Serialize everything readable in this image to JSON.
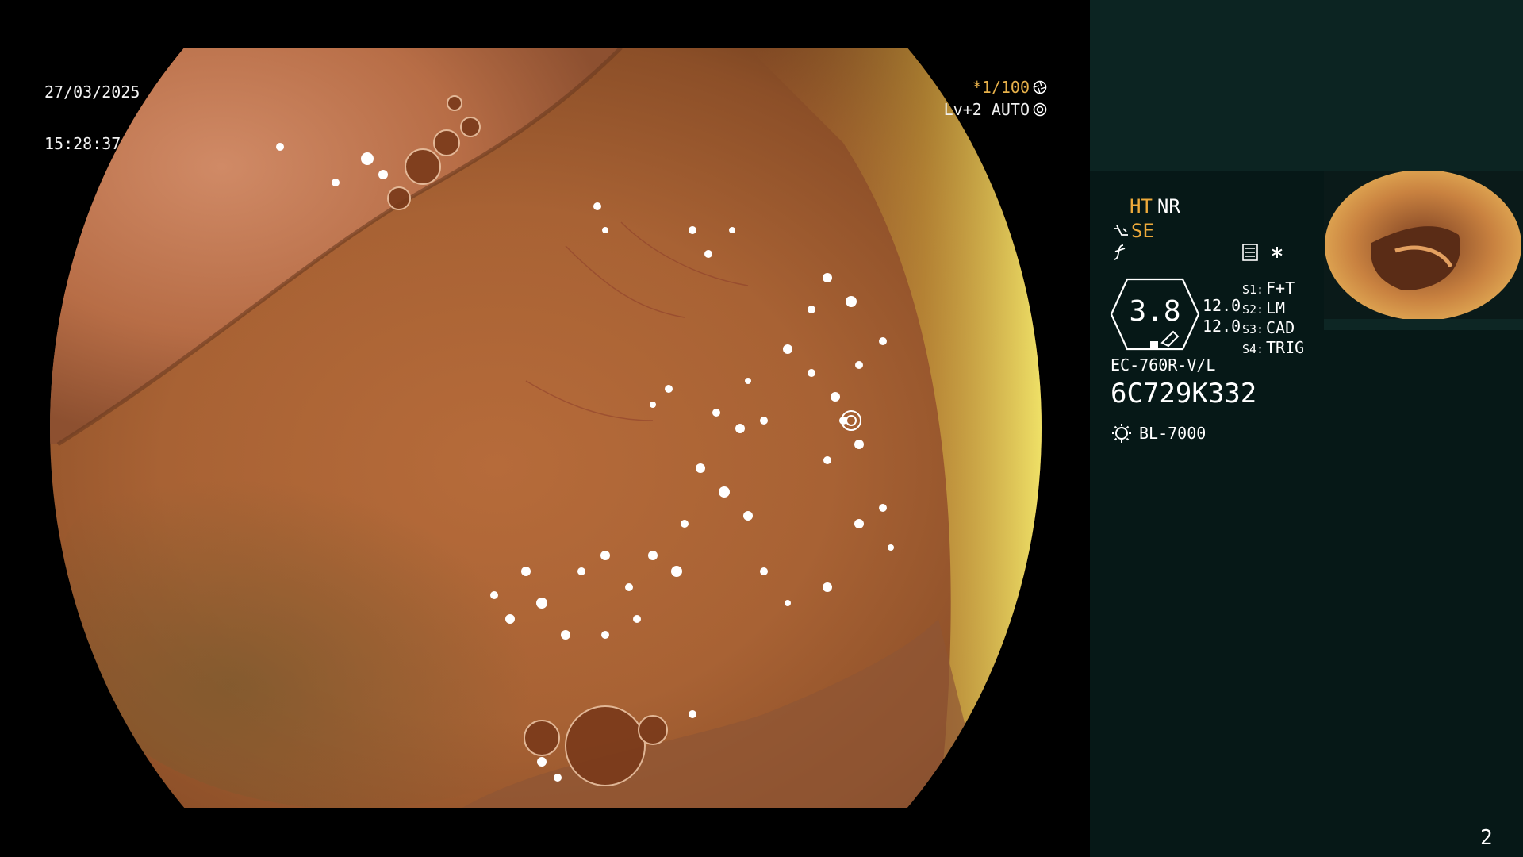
{
  "overlay": {
    "date": "27/03/2025",
    "time": "15:28:37",
    "shutter": "*1/100",
    "level": "Lv+2 AUTO"
  },
  "settings": {
    "ht": "HT",
    "nr": "NR",
    "se": "SE",
    "gauge_value": "3.8",
    "gauge_num_1": "12.0",
    "gauge_num_2": "12.0",
    "scope_modes": [
      {
        "key": "S1:",
        "value": "F+T"
      },
      {
        "key": "S2:",
        "value": "LM"
      },
      {
        "key": "S3:",
        "value": "CAD"
      },
      {
        "key": "S4:",
        "value": "TRIG"
      }
    ],
    "model": "EC-760R-V/L",
    "serial": "6C729K332",
    "light_source": "BL-7000"
  },
  "page_number": "2",
  "colors": {
    "amber": "#eeaa3b",
    "panel_bg": "#061817",
    "panel_top": "#0c2422"
  },
  "icons": {
    "shutter": "aperture-icon",
    "level": "sun-cog-icon",
    "structure": "structure-enhance-icon",
    "color": "color-enhance-icon",
    "menu": "menu-icon",
    "asterisk": "asterisk-icon",
    "light": "light-source-icon"
  }
}
